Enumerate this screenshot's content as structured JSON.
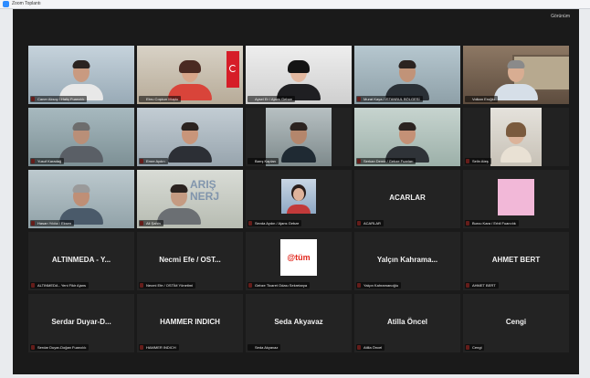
{
  "app": {
    "title": "Zoom Toplantı",
    "view_mode": "Görünüm"
  },
  "tiles": [
    {
      "type": "video",
      "name": "Caner Aksoy / Haliç Fuarcılık",
      "mic_muted": true
    },
    {
      "type": "video",
      "name": "Ebru Coşkun Muşlu",
      "mic_muted": false
    },
    {
      "type": "video",
      "name": "Aysel Er / Ajans Gebze",
      "mic_muted": false
    },
    {
      "type": "video",
      "name": "Murat Kaya / İSTANBUL BÖLGESİ",
      "mic_muted": true
    },
    {
      "type": "video",
      "name": "Volkan Eroğlu",
      "mic_muted": false
    },
    {
      "type": "video",
      "name": "Yusuf Karadağ",
      "mic_muted": true
    },
    {
      "type": "video",
      "name": "Emre Aydın",
      "mic_muted": true
    },
    {
      "type": "video",
      "name": "Barış Kaplan",
      "mic_muted": false
    },
    {
      "type": "video",
      "name": "Serkan Demir / Gebze Fuarları",
      "mic_muted": true
    },
    {
      "type": "video",
      "name": "Selin Ateş",
      "mic_muted": true
    },
    {
      "type": "video",
      "name": "Hasan Yıldız / Eksen",
      "mic_muted": true
    },
    {
      "type": "video",
      "name": "Ali Şahin",
      "mic_muted": true
    },
    {
      "type": "avatar",
      "name": "Sevda Aydın / Ajans Gebze",
      "mic_muted": true
    },
    {
      "type": "text",
      "display_name": "ACARLAR",
      "name": "ACARLAR",
      "mic_muted": true
    },
    {
      "type": "avatar-pink",
      "name": "Burcu Kara / Erbil Fuarcılık",
      "mic_muted": true
    },
    {
      "type": "text",
      "display_name": "ALTINMEDA - Y...",
      "name": "ALTINMEDA - Yeni Fikir Ajans",
      "mic_muted": true
    },
    {
      "type": "text",
      "display_name": "Necmi Efe / OST...",
      "name": "Necmi Efe / OSTİM Yönetimi",
      "mic_muted": true
    },
    {
      "type": "logo",
      "logo_text": "@tüm",
      "name": "Gebze Ticaret Odası Sekretarya",
      "mic_muted": true
    },
    {
      "type": "text",
      "display_name": "Yalçın Kahrama...",
      "name": "Yalçın Kahramanoğlu",
      "mic_muted": true
    },
    {
      "type": "text",
      "display_name": "AHMET BERT",
      "name": "AHMET BERT",
      "mic_muted": true
    },
    {
      "type": "text",
      "display_name": "Serdar Duyar-D...",
      "name": "Serdar Duyar-Doğan Fuarcılık",
      "mic_muted": true
    },
    {
      "type": "text",
      "display_name": "HAMMER INDICH",
      "name": "HAMMER INDICH",
      "mic_muted": true
    },
    {
      "type": "text",
      "display_name": "Sedа Akyavaz",
      "name": "Seda Akyavaz",
      "mic_muted": false
    },
    {
      "type": "text",
      "display_name": "Atilla Öncel",
      "name": "Atilla Öncel",
      "mic_muted": true
    },
    {
      "type": "text",
      "display_name": "Cengi",
      "name": "Cengi",
      "mic_muted": true
    }
  ]
}
